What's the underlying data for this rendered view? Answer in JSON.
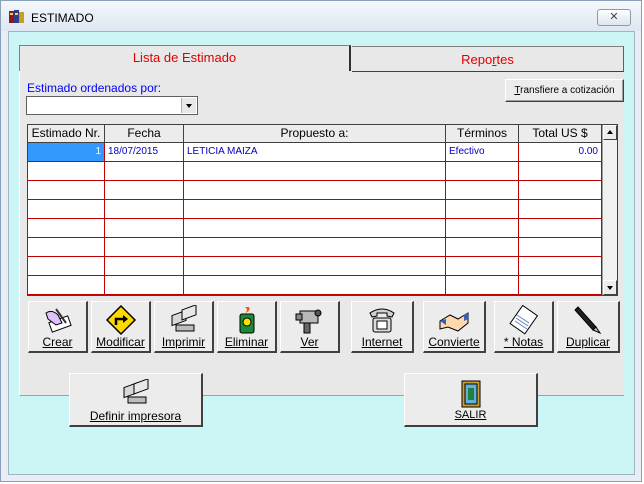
{
  "window": {
    "title": "ESTIMADO",
    "close_label": "✕"
  },
  "tabs": [
    {
      "label": "Lista de Estimado"
    },
    {
      "label": "Reportes"
    }
  ],
  "order": {
    "label": "Estimado ordenados por:",
    "value": ""
  },
  "transfer_button": "Transfiere a cotización",
  "table": {
    "headers": [
      "Estimado Nr.",
      "Fecha",
      "Propuesto a:",
      "Términos",
      "Total  US $"
    ],
    "rows": [
      [
        "1",
        "18/07/2015",
        "LETICIA MAIZA",
        "Efectivo",
        "0.00"
      ]
    ]
  },
  "toolbar": [
    {
      "label": "Crear",
      "icon": "create-hand-icon"
    },
    {
      "label": "Modificar",
      "icon": "modify-sign-icon"
    },
    {
      "label": "Imprimir",
      "icon": "printer-icon"
    },
    {
      "label": "Eliminar",
      "icon": "trash-can-icon"
    },
    {
      "label": "Ver",
      "icon": "camera-icon"
    },
    {
      "label": "Internet",
      "icon": "telephone-icon"
    },
    {
      "label": "Convierte",
      "icon": "handshake-icon"
    },
    {
      "label": "* Notas",
      "icon": "notepad-icon"
    },
    {
      "label": "Duplicar",
      "icon": "pen-icon"
    }
  ],
  "bottom": {
    "printer_button": "Definir impresora",
    "exit_button": "SALIR"
  },
  "colors": {
    "background": "#ccf5f5",
    "tab_text": "#e00000",
    "grid_lines": "#c00000",
    "data_text": "#0000c0",
    "label_blue": "#0000ff"
  }
}
